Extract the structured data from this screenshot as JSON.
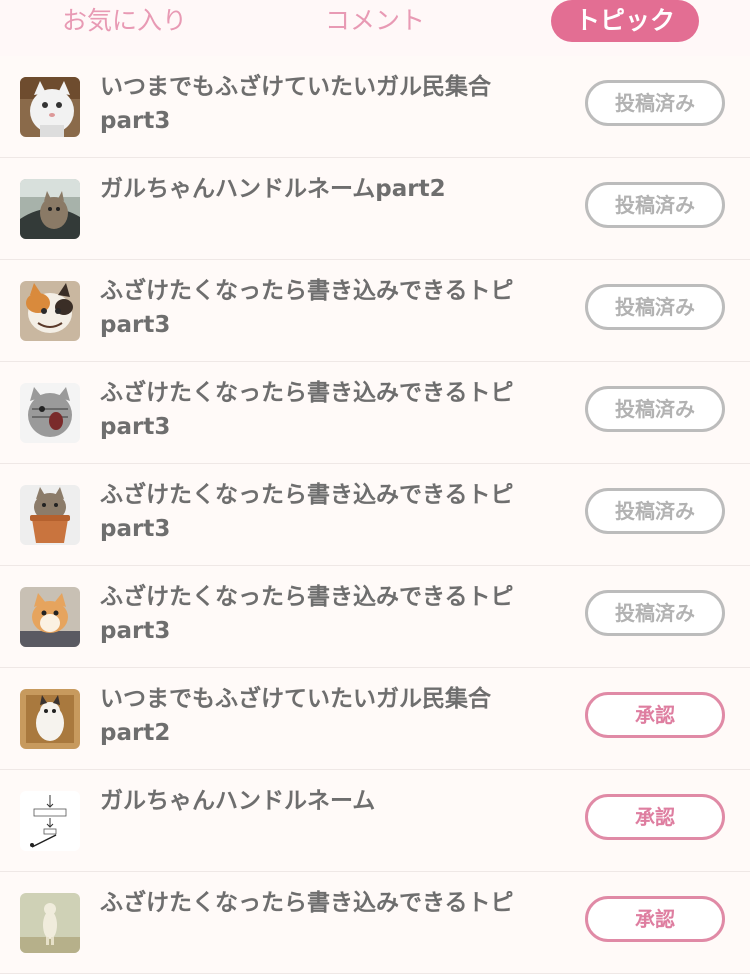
{
  "tabs": [
    {
      "label": "お気に入り",
      "active": false
    },
    {
      "label": "コメント",
      "active": false
    },
    {
      "label": "トピック",
      "active": true
    }
  ],
  "colors": {
    "accent": "#e36e93",
    "posted_border": "#bcbcbc",
    "approve_border": "#e08aa6"
  },
  "topics": [
    {
      "title": "いつまでもふざけていたいガル民集合\npart3",
      "status": "投稿済み",
      "thumb": "white-cat-icon"
    },
    {
      "title": "ガルちゃんハンドルネームpart2",
      "status": "投稿済み",
      "thumb": "cat-in-car-icon"
    },
    {
      "title": "ふざけたくなったら書き込みできるトピ\npart3",
      "status": "投稿済み",
      "thumb": "calico-cat-icon"
    },
    {
      "title": "ふざけたくなったら書き込みできるトピ\npart3",
      "status": "投稿済み",
      "thumb": "screaming-cat-icon"
    },
    {
      "title": "ふざけたくなったら書き込みできるトピ\npart3",
      "status": "投稿済み",
      "thumb": "cat-in-pot-icon"
    },
    {
      "title": "ふざけたくなったら書き込みできるトピ\npart3",
      "status": "投稿済み",
      "thumb": "orange-cat-icon"
    },
    {
      "title": "いつまでもふざけていたいガル民集合\npart2",
      "status": "承認",
      "thumb": "cat-in-box-icon"
    },
    {
      "title": "ガルちゃんハンドルネーム",
      "status": "承認",
      "thumb": "handle-name-diagram-icon"
    },
    {
      "title": "ふざけたくなったら書き込みできるトピ",
      "status": "承認",
      "thumb": "standing-animal-icon"
    }
  ]
}
